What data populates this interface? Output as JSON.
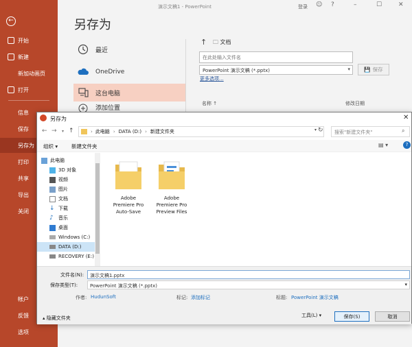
{
  "app": {
    "title_bar": "演示文稿1 - PowerPoint",
    "sign_in": "登录"
  },
  "nav": {
    "back_icon": "back-arrow-icon",
    "items": [
      {
        "label": "开始"
      },
      {
        "label": "新建"
      },
      {
        "label": "新加动画页"
      },
      {
        "label": "打开"
      },
      {
        "label": "信息"
      },
      {
        "label": "保存"
      },
      {
        "label": "另存为"
      },
      {
        "label": "打印"
      },
      {
        "label": "共享"
      },
      {
        "label": "导出"
      },
      {
        "label": "关闭"
      },
      {
        "label": "帐户"
      },
      {
        "label": "反馈"
      },
      {
        "label": "选项"
      }
    ]
  },
  "page_title": "另存为",
  "locations": [
    {
      "label": "最近",
      "icon": "clock-icon"
    },
    {
      "label": "OneDrive",
      "icon": "cloud-icon"
    },
    {
      "label": "这台电脑",
      "icon": "computer-icon"
    },
    {
      "label": "添加位置",
      "icon": "add-location-icon"
    }
  ],
  "right_pane": {
    "folder": "文档",
    "filename_placeholder": "在此处输入文件名",
    "filetype": "PowerPoint 演示文稿 (*.pptx)",
    "save": "保存",
    "more_options": "更多选项...",
    "col_name": "名称 ↑",
    "col_modified": "修改日期"
  },
  "dialog": {
    "title": "另存为",
    "path": [
      "此电脑",
      "DATA (D:)",
      "新建文件夹"
    ],
    "search_placeholder": "搜索\"新建文件夹\"",
    "organize": "组织 ▾",
    "new_folder": "新建文件夹",
    "tree": [
      {
        "label": "此电脑"
      },
      {
        "label": "3D 对象"
      },
      {
        "label": "视频"
      },
      {
        "label": "图片"
      },
      {
        "label": "文档"
      },
      {
        "label": "下载"
      },
      {
        "label": "音乐"
      },
      {
        "label": "桌面"
      },
      {
        "label": "Windows (C:)"
      },
      {
        "label": "DATA (D:)"
      },
      {
        "label": "RECOVERY (E:)"
      }
    ],
    "files": [
      {
        "line1": "Adobe",
        "line2": "Premiere Pro",
        "line3": "Auto-Save"
      },
      {
        "line1": "Adobe",
        "line2": "Premiere Pro",
        "line3": "Preview Files"
      }
    ],
    "filename_label": "文件名(N):",
    "filename_value": "演示文稿1.pptx",
    "filetype_label": "保存类型(T):",
    "filetype_value": "PowerPoint 演示文稿 (*.pptx)",
    "author_label": "作者:",
    "author_value": "HudunSoft",
    "tags_label": "标记:",
    "tags_value": "添加标记",
    "title_label": "标题:",
    "title_value": "PowerPoint 演示文稿",
    "hide_folders": "隐藏文件夹",
    "tools": "工具(L)",
    "save": "保存(S)",
    "cancel": "取消"
  },
  "colors": {
    "accent": "#b7472a",
    "selected_location": "#f7d0c2",
    "link": "#1e6fbf"
  }
}
